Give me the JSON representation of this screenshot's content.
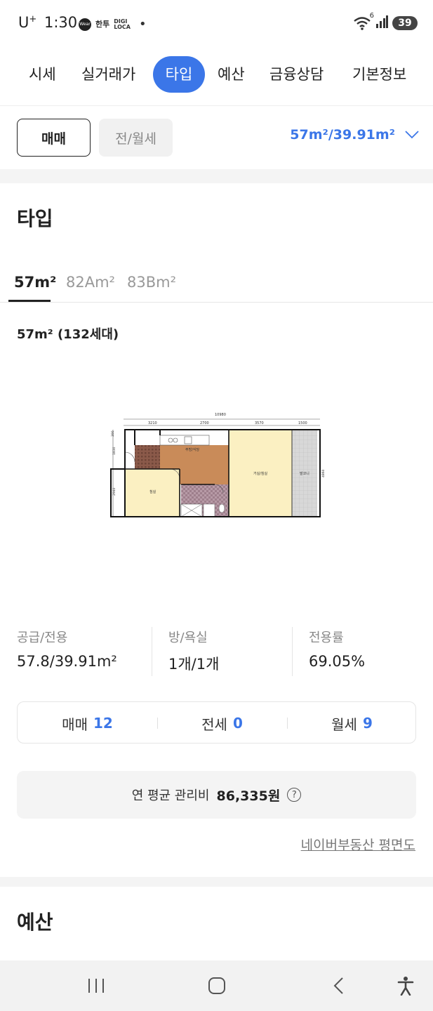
{
  "status_bar": {
    "carrier": "U",
    "carrier_sup": "+",
    "time": "1:30",
    "app1": "Wear",
    "app2": "한투",
    "app3_line1": "DIGI",
    "app3_line2": "LOCA",
    "bullet": "•",
    "wifi_badge": "6",
    "battery": "39"
  },
  "tabs": [
    "시세",
    "실거래가",
    "타입",
    "예산",
    "금융상담",
    "기본정보"
  ],
  "active_tab": "타입",
  "trade_types": {
    "sale": "매매",
    "rent": "전/월세"
  },
  "area_selector": "57m²/39.91m²",
  "type_section": {
    "title": "타입",
    "type_tabs": [
      "57m²",
      "82Am²",
      "83Bm²"
    ],
    "subtitle": "57m² (132세대)"
  },
  "floorplan": {
    "dims_top": [
      "10980"
    ],
    "dims_top_parts": [
      "3210",
      "2700",
      "3570",
      "1500"
    ],
    "dims_left": [
      "390",
      "1830",
      "3600",
      "2940"
    ],
    "dims_right": [
      "4860"
    ],
    "rooms": {
      "kitchen": "주방/식당",
      "living": "거실/침실",
      "balcony": "발코니",
      "bedroom": "침실"
    }
  },
  "info": [
    {
      "label": "공급/전용",
      "value": "57.8/39.91m²"
    },
    {
      "label": "방/욕실",
      "value": "1개/1개"
    },
    {
      "label": "전용률",
      "value": "69.05%"
    }
  ],
  "counts": [
    {
      "label": "매매",
      "value": "12"
    },
    {
      "label": "전세",
      "value": "0"
    },
    {
      "label": "월세",
      "value": "9"
    }
  ],
  "fee": {
    "label": "연 평균 관리비",
    "value": "86,335원",
    "help": "?"
  },
  "naver_link": "네이버부동산 평면도",
  "budget_section": {
    "title": "예산"
  },
  "colors": {
    "accent": "#3b76e8"
  }
}
